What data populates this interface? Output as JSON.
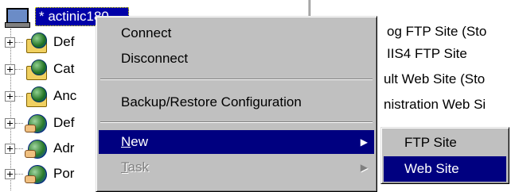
{
  "tree": {
    "root_label": "* actinic180",
    "nodes": [
      {
        "label": "Def",
        "icon": "folder-globe-icon"
      },
      {
        "label": "Cat",
        "icon": "folder-globe-icon"
      },
      {
        "label": "Anc",
        "icon": "folder-globe-icon"
      },
      {
        "label": "Def",
        "icon": "globe-icon"
      },
      {
        "label": "Adr",
        "icon": "globe-icon"
      },
      {
        "label": "Por",
        "icon": "globe-icon"
      }
    ]
  },
  "list": {
    "rows": [
      "og FTP Site (Sto",
      "IIS4 FTP Site",
      "ult Web Site (Sto",
      "nistration Web Si"
    ]
  },
  "context_menu": {
    "connect": "Connect",
    "disconnect": "Disconnect",
    "backup_restore": "Backup/Restore Configuration",
    "new_mnemonic": "N",
    "new_rest": "ew",
    "task_mnemonic": "T",
    "task_rest": "ask"
  },
  "submenu": {
    "ftp_site": "FTP Site",
    "web_site": "Web Site"
  },
  "colors": {
    "selection": "#000080",
    "menu_face": "#c0c0c0",
    "disabled_text": "#808080"
  }
}
